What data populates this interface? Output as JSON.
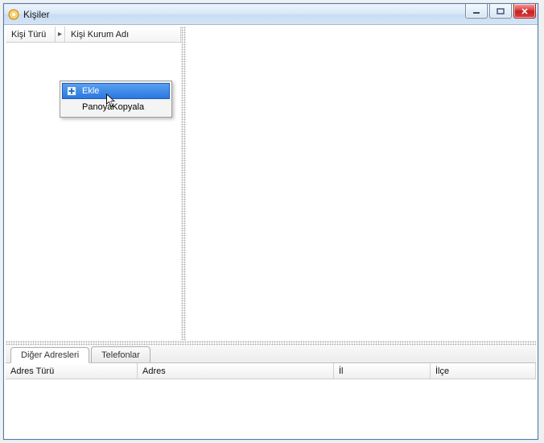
{
  "window": {
    "title": "Kişiler"
  },
  "topPanel": {
    "columns": [
      "Kişi Türü",
      "Kişi Kurum Adı"
    ]
  },
  "contextMenu": {
    "items": [
      {
        "label": "Ekle",
        "icon": "plus",
        "highlighted": true
      },
      {
        "label": "PanoyaKopyala",
        "icon": "",
        "highlighted": false
      }
    ]
  },
  "bottomTabs": {
    "tabs": [
      {
        "label": "Diğer Adresleri",
        "active": true
      },
      {
        "label": "Telefonlar",
        "active": false
      }
    ]
  },
  "addressGrid": {
    "columns": [
      "Adres Türü",
      "Adres",
      "İl",
      "İlçe"
    ]
  }
}
